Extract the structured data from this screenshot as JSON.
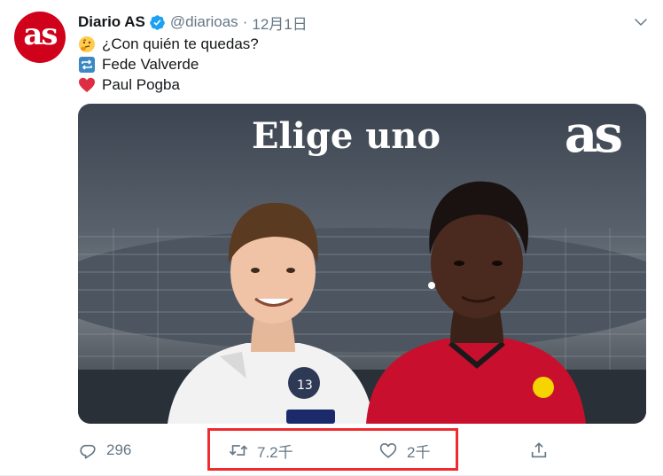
{
  "tweet": {
    "author": {
      "name": "Diario AS",
      "handle": "@diarioas",
      "avatar_text": "as",
      "verified": true
    },
    "separator": "·",
    "date": "12月1日",
    "lines": [
      {
        "icon": "thinking-face-emoji",
        "text": "¿Con quién te quedas?"
      },
      {
        "icon": "repeat-emoji",
        "text": "Fede Valverde"
      },
      {
        "icon": "red-heart-emoji",
        "text": "Paul Pogba"
      }
    ],
    "media": {
      "title": "Elige uno",
      "logo": "as"
    },
    "actions": {
      "reply_count": "296",
      "retweet_count": "7.2千",
      "like_count": "2千"
    }
  },
  "colors": {
    "brand_red": "#d0021b",
    "verified_blue": "#1da1f2",
    "muted_text": "#657786",
    "highlight_red": "#ee2b2f"
  }
}
